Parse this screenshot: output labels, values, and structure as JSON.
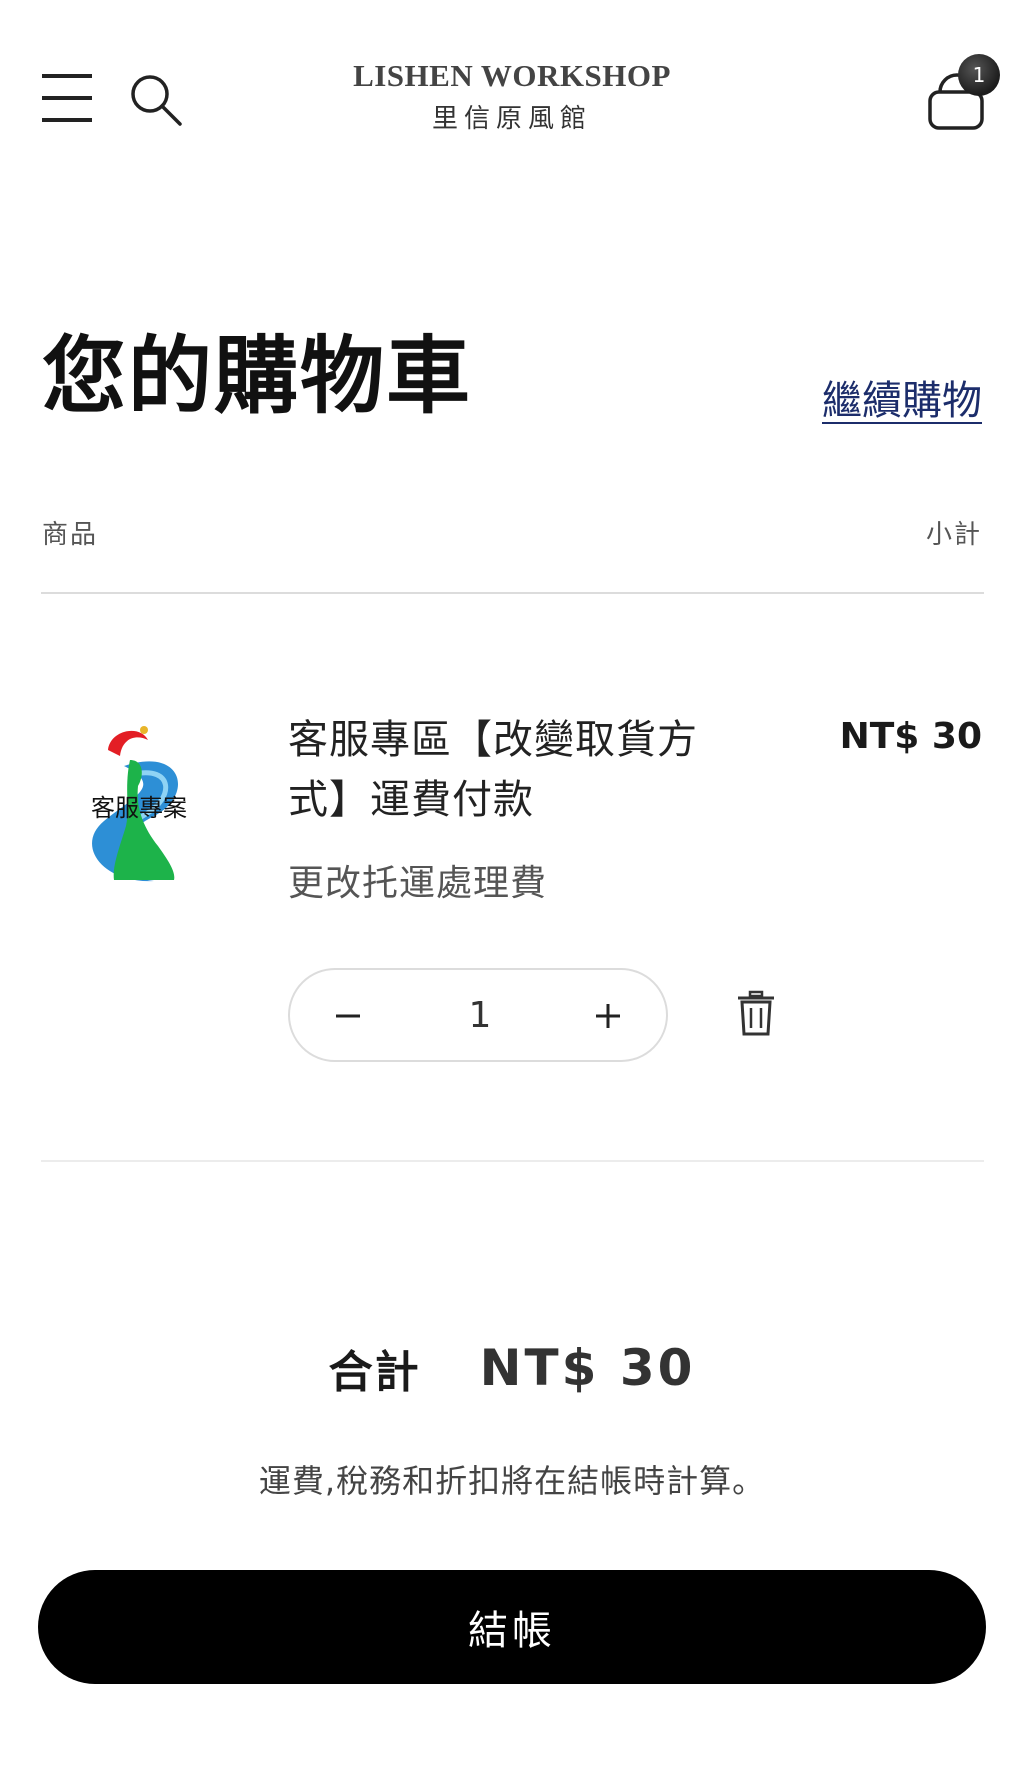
{
  "header": {
    "logo_en": "LISHEN WORKSHOP",
    "logo_zh": "里信原風館",
    "cart_count": "1"
  },
  "cart": {
    "title": "您的購物車",
    "continue_label": "繼續購物",
    "col_product": "商品",
    "col_subtotal": "小計",
    "items": [
      {
        "name": "客服專區【改變取貨方式】運費付款",
        "variant": "更改托運處理費",
        "price": "NT$ 30",
        "quantity": "1",
        "thumbnail_text": "客服專案"
      }
    ],
    "total_label": "合計",
    "total_value": "NT$ 30",
    "tax_note": "運費,稅務和折扣將在結帳時計算。",
    "checkout_label": "結帳"
  },
  "colors": {
    "link": "#1c2d6b",
    "button_bg": "#000000",
    "divider": "#dcdcdc"
  }
}
